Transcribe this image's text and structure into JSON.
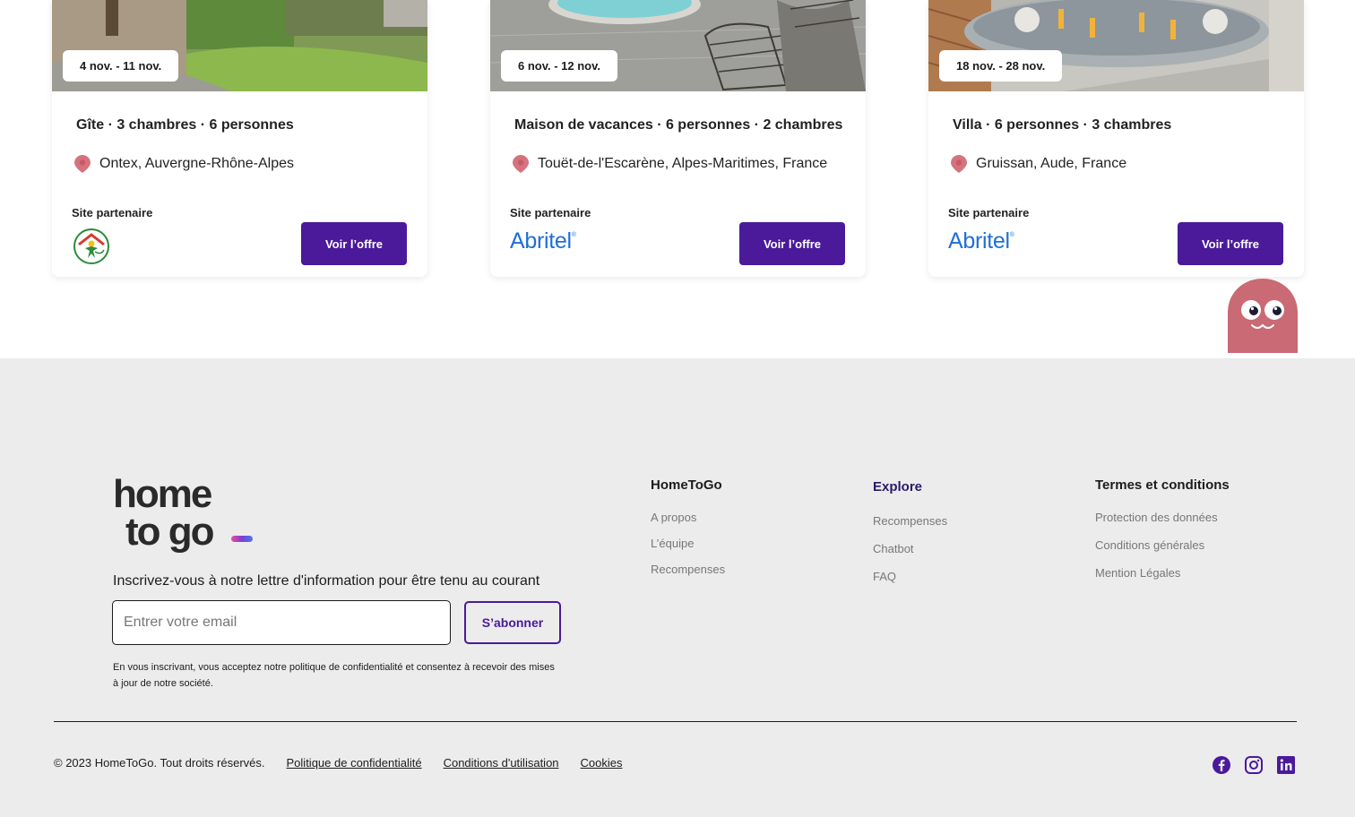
{
  "cards": [
    {
      "date": "4 nov. - 11 nov.",
      "title": "Gîte · 3 chambres · 6 personnes",
      "location": "Ontex, Auvergne-Rhône-Alpes",
      "partner_label": "Site partenaire",
      "partner": "Gîtes de France",
      "button": "Voir l’offre"
    },
    {
      "date": "6 nov. - 12 nov.",
      "title": "Maison de vacances · 6 personnes · 2 chambres",
      "location": "Touët-de-l'Escarène, Alpes-Maritimes, France",
      "partner_label": "Site partenaire",
      "partner": "Abritel",
      "button": "Voir l’offre"
    },
    {
      "date": "18 nov. - 28 nov.",
      "title": "Villa · 6 personnes · 3 chambres",
      "location": "Gruissan, Aude, France",
      "partner_label": "Site partenaire",
      "partner": "Abritel",
      "button": "Voir l’offre"
    }
  ],
  "footer": {
    "logo_line1": "home",
    "logo_line2": "to go",
    "newsletter_text": "Inscrivez-vous à notre lettre d'information pour être tenu au courant",
    "email_placeholder": "Entrer votre email",
    "subscribe_label": "S’abonner",
    "consent_text": "En vous inscrivant, vous acceptez notre politique de confidentialité et consentez à recevoir des mises à jour de notre société.",
    "columns": [
      {
        "title": "HomeToGo",
        "links": [
          "A propos",
          "L’équipe",
          "Recompenses"
        ]
      },
      {
        "title": "Explore",
        "links": [
          "Recompenses",
          "Chatbot",
          "FAQ"
        ]
      },
      {
        "title": "Termes et conditions",
        "links": [
          "Protection des données",
          "Conditions générales",
          "Mention Légales"
        ]
      }
    ],
    "copyright": "© 2023 HomeToGo. Tout droits réservés.",
    "legal_links": [
      "Politique de confidentialité",
      "Conditions d'utilisation",
      "Cookies"
    ],
    "social_icons": [
      "facebook-icon",
      "instagram-icon",
      "linkedin-icon"
    ]
  },
  "colors": {
    "accent": "#4a1a9a",
    "footer_bg": "#ececec",
    "pin": "#d4737e",
    "abritel": "#1f6fd6",
    "mascot": "#c96a74"
  }
}
